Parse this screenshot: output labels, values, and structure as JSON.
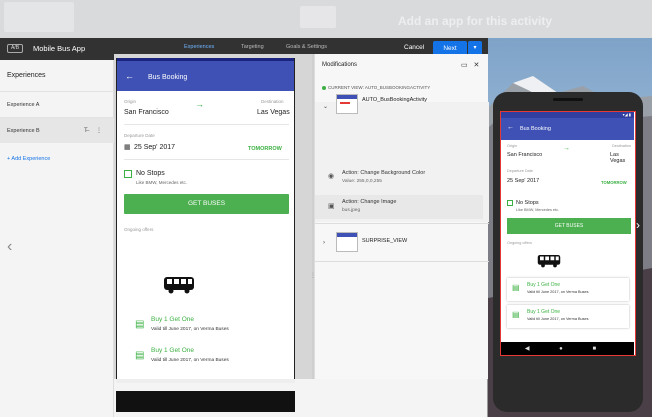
{
  "background": {
    "title": "Add an app for this activity"
  },
  "topbar": {
    "badge": "A/B",
    "app_title": "Mobile Bus App",
    "tabs": [
      {
        "label": "Experiences"
      },
      {
        "label": "Targeting"
      },
      {
        "label": "Goals & Settings"
      }
    ],
    "cancel_label": "Cancel",
    "next_label": "Next",
    "next_dropdown": "▾"
  },
  "sidebar": {
    "title": "Experiences",
    "items": [
      {
        "label": "Experience A"
      },
      {
        "label": "Experience B"
      }
    ],
    "add_label": "+ Add Experience"
  },
  "toolbar": {
    "icons": [
      "collapse-icon",
      "code-icon",
      "device-icon"
    ]
  },
  "preview": {
    "header_title": "Bus Booking",
    "origin_label": "Origin",
    "origin_value": "San Francisco",
    "destination_label": "Destination",
    "destination_value": "Las Vegas",
    "departure_label": "Departure Date",
    "departure_value": "25 Sep' 2017",
    "tomorrow_label": "TOMORROW",
    "nostops_label": "No Stops",
    "nostops_sub": "Like BMW, Mercedes etc.",
    "get_buses_label": "GET BUSES",
    "offers_label": "Ongoing offers",
    "offers": [
      {
        "title": "Buy 1 Get One",
        "subtitle": "Valid till June 2017, on Verma Buses"
      },
      {
        "title": "Buy 1 Get One",
        "subtitle": "Valid till June 2017, on Verma Buses"
      }
    ]
  },
  "modifications": {
    "title": "Modifications",
    "current_view": "CURRENT VIEW: AUTO_BUSBOOKINGACTIVITY",
    "views": [
      {
        "name": "AUTO_BusBookingActivity",
        "actions": [
          {
            "label": "Action: Change Background Color",
            "value": "Value:    255,0,0,255"
          },
          {
            "label": "Action: Change Image",
            "value": "bus.jpeg"
          }
        ]
      },
      {
        "name": "SURPRISE_VIEW"
      }
    ]
  },
  "device": {
    "status": "▾◢ ▮",
    "nav": "◀ ● ■"
  }
}
